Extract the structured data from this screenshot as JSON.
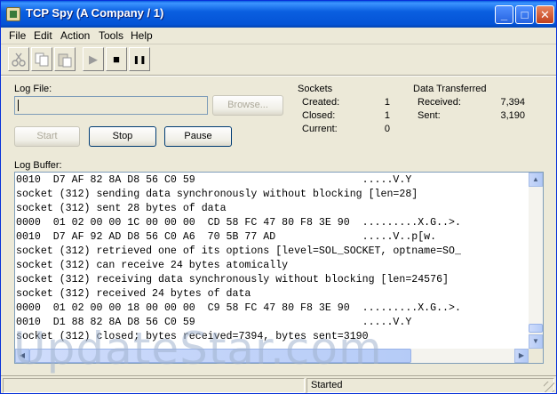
{
  "window": {
    "title": "TCP Spy (A Company / 1)",
    "minimize_glyph": "_",
    "maximize_glyph": "□",
    "close_glyph": "✕"
  },
  "menu": [
    {
      "label": "File"
    },
    {
      "label": "Edit"
    },
    {
      "label": "Action"
    },
    {
      "label": "Tools"
    },
    {
      "label": "Help"
    }
  ],
  "toolbar": {
    "cut_icon": "scissors-icon",
    "copy_icon": "copy-icon",
    "paste_icon": "paste-icon",
    "play_glyph": "▶",
    "stop_glyph": "■",
    "pause_glyph": "❚❚"
  },
  "logfile": {
    "label": "Log File:",
    "value": "",
    "browse_label": "Browse..."
  },
  "controls": {
    "start_label": "Start",
    "stop_label": "Stop",
    "pause_label": "Pause"
  },
  "sockets": {
    "heading": "Sockets",
    "created_label": "Created:",
    "created_value": "1",
    "closed_label": "Closed:",
    "closed_value": "1",
    "current_label": "Current:",
    "current_value": "0"
  },
  "data_transferred": {
    "heading": "Data Transferred",
    "received_label": "Received:",
    "received_value": "7,394",
    "sent_label": "Sent:",
    "sent_value": "3,190"
  },
  "log_buffer": {
    "label": "Log Buffer:",
    "lines": [
      "0010  D7 AF 82 8A D8 56 C0 59                           .....V.Y",
      "socket (312) sending data synchronously without blocking [len=28]",
      "socket (312) sent 28 bytes of data",
      "0000  01 02 00 00 1C 00 00 00  CD 58 FC 47 80 F8 3E 90  .........X.G..>.",
      "0010  D7 AF 92 AD D8 56 C0 A6  70 5B 77 AD              .....V..p[w.",
      "socket (312) retrieved one of its options [level=SOL_SOCKET, optname=SO_",
      "socket (312) can receive 24 bytes atomically",
      "socket (312) receiving data synchronously without blocking [len=24576]",
      "socket (312) received 24 bytes of data",
      "0000  01 02 00 00 18 00 00 00  C9 58 FC 47 80 F8 3E 90  .........X.G..>.",
      "0010  D1 88 82 8A D8 56 C0 59                           .....V.Y",
      "socket (312) closed; bytes received=7394, bytes sent=3190"
    ]
  },
  "status": {
    "text": "Started"
  },
  "watermark": "UpdateStar.com",
  "colors": {
    "titlebar": "#0a5fe0",
    "window_bg": "#ece9d8",
    "field_border": "#7f9db9"
  }
}
